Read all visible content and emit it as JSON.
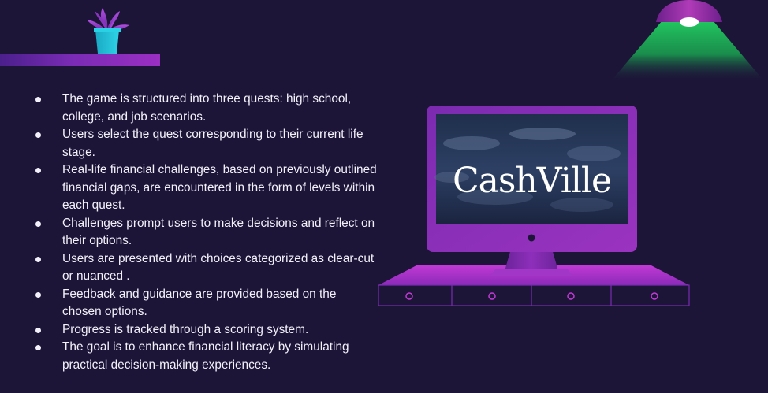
{
  "bullets": [
    "The game is structured into three quests: high school, college, and job scenarios.",
    "Users select the quest corresponding to their current life stage.",
    "Real-life financial challenges, based on previously outlined financial gaps, are encountered in the form of levels within each quest.",
    "Challenges prompt users to make decisions and reflect on their options.",
    "Users are presented with choices categorized as clear-cut or nuanced .",
    "Feedback and guidance are provided based on the chosen options.",
    "Progress is tracked through a scoring system.",
    "The goal is to enhance financial literacy by simulating practical decision-making experiences."
  ],
  "screen": {
    "brand": "CashVille"
  },
  "icons": {
    "plant": "potted-plant-icon",
    "lamp": "ceiling-lamp-icon",
    "computer": "desktop-computer-icon"
  },
  "colors": {
    "background": "#1c1538",
    "shelf": "#7a2bb5",
    "monitor": "#8a2fb8",
    "desk": "#b52fd0",
    "lamp_light": "#1fbf5a",
    "lamp_shade": "#8e2ca8",
    "plant_pot": "#23c4d9",
    "plant_leaves": "#9b3fc8",
    "text": "#f4f1fa"
  }
}
